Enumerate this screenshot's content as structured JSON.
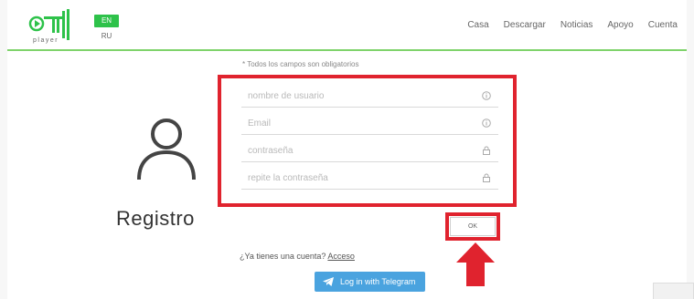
{
  "header": {
    "logo_text": "player",
    "lang_active": "EN",
    "lang_other": "RU",
    "nav": [
      "Casa",
      "Descargar",
      "Noticias",
      "Apoyo",
      "Cuenta"
    ]
  },
  "form": {
    "required_note": "* Todos los campos son obligatorios",
    "title": "Registro",
    "fields": [
      {
        "placeholder": "nombre de usuario",
        "icon": "info-icon"
      },
      {
        "placeholder": "Email",
        "icon": "info-icon"
      },
      {
        "placeholder": "contraseña",
        "icon": "lock-icon"
      },
      {
        "placeholder": "repite la contraseña",
        "icon": "lock-icon"
      }
    ],
    "ok_label": "OK",
    "account_prompt": "¿Ya tienes una cuenta?",
    "login_link": "Acceso",
    "telegram_label": "Log in with Telegram"
  },
  "colors": {
    "accent_green": "#2ec24a",
    "annotation_red": "#e0232e",
    "telegram_blue": "#4aa3df"
  }
}
